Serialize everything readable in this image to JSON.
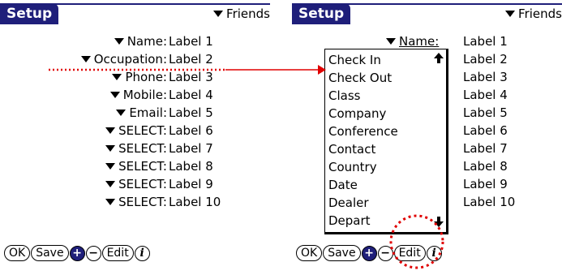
{
  "left": {
    "title": "Setup",
    "category": "Friends",
    "rows": [
      {
        "label": "Name:",
        "value": "Label 1"
      },
      {
        "label": "Occupation:",
        "value": "Label 2"
      },
      {
        "label": "Phone:",
        "value": "Label 3"
      },
      {
        "label": "Mobile:",
        "value": "Label 4"
      },
      {
        "label": "Email:",
        "value": "Label 5"
      },
      {
        "label": "SELECT:",
        "value": "Label 6"
      },
      {
        "label": "SELECT:",
        "value": "Label 7"
      },
      {
        "label": "SELECT:",
        "value": "Label 8"
      },
      {
        "label": "SELECT:",
        "value": "Label 9"
      },
      {
        "label": "SELECT:",
        "value": "Label 10"
      }
    ],
    "buttons": {
      "ok": "OK",
      "save": "Save",
      "plus": "+",
      "minus": "−",
      "edit": "Edit",
      "info": "i"
    }
  },
  "right": {
    "title": "Setup",
    "category": "Friends",
    "name_label": "Name:",
    "values": [
      "Label 1",
      "Label 2",
      "Label 3",
      "Label 4",
      "Label 5",
      "Label 6",
      "Label 7",
      "Label 8",
      "Label 9",
      "Label 10"
    ],
    "popup_items": [
      "Check In",
      "Check Out",
      "Class",
      "Company",
      "Conference",
      "Contact",
      "Country",
      "Date",
      "Dealer",
      "Depart"
    ],
    "buttons": {
      "ok": "OK",
      "save": "Save",
      "plus": "+",
      "minus": "−",
      "edit": "Edit",
      "info": "i"
    }
  },
  "icons": {
    "dropdown": "dropdown-triangle-icon",
    "scroll_up": "scroll-up-arrow-icon",
    "scroll_down": "scroll-down-arrow-icon"
  },
  "colors": {
    "accent": "#1f1f7a",
    "annotation": "#e00000"
  }
}
